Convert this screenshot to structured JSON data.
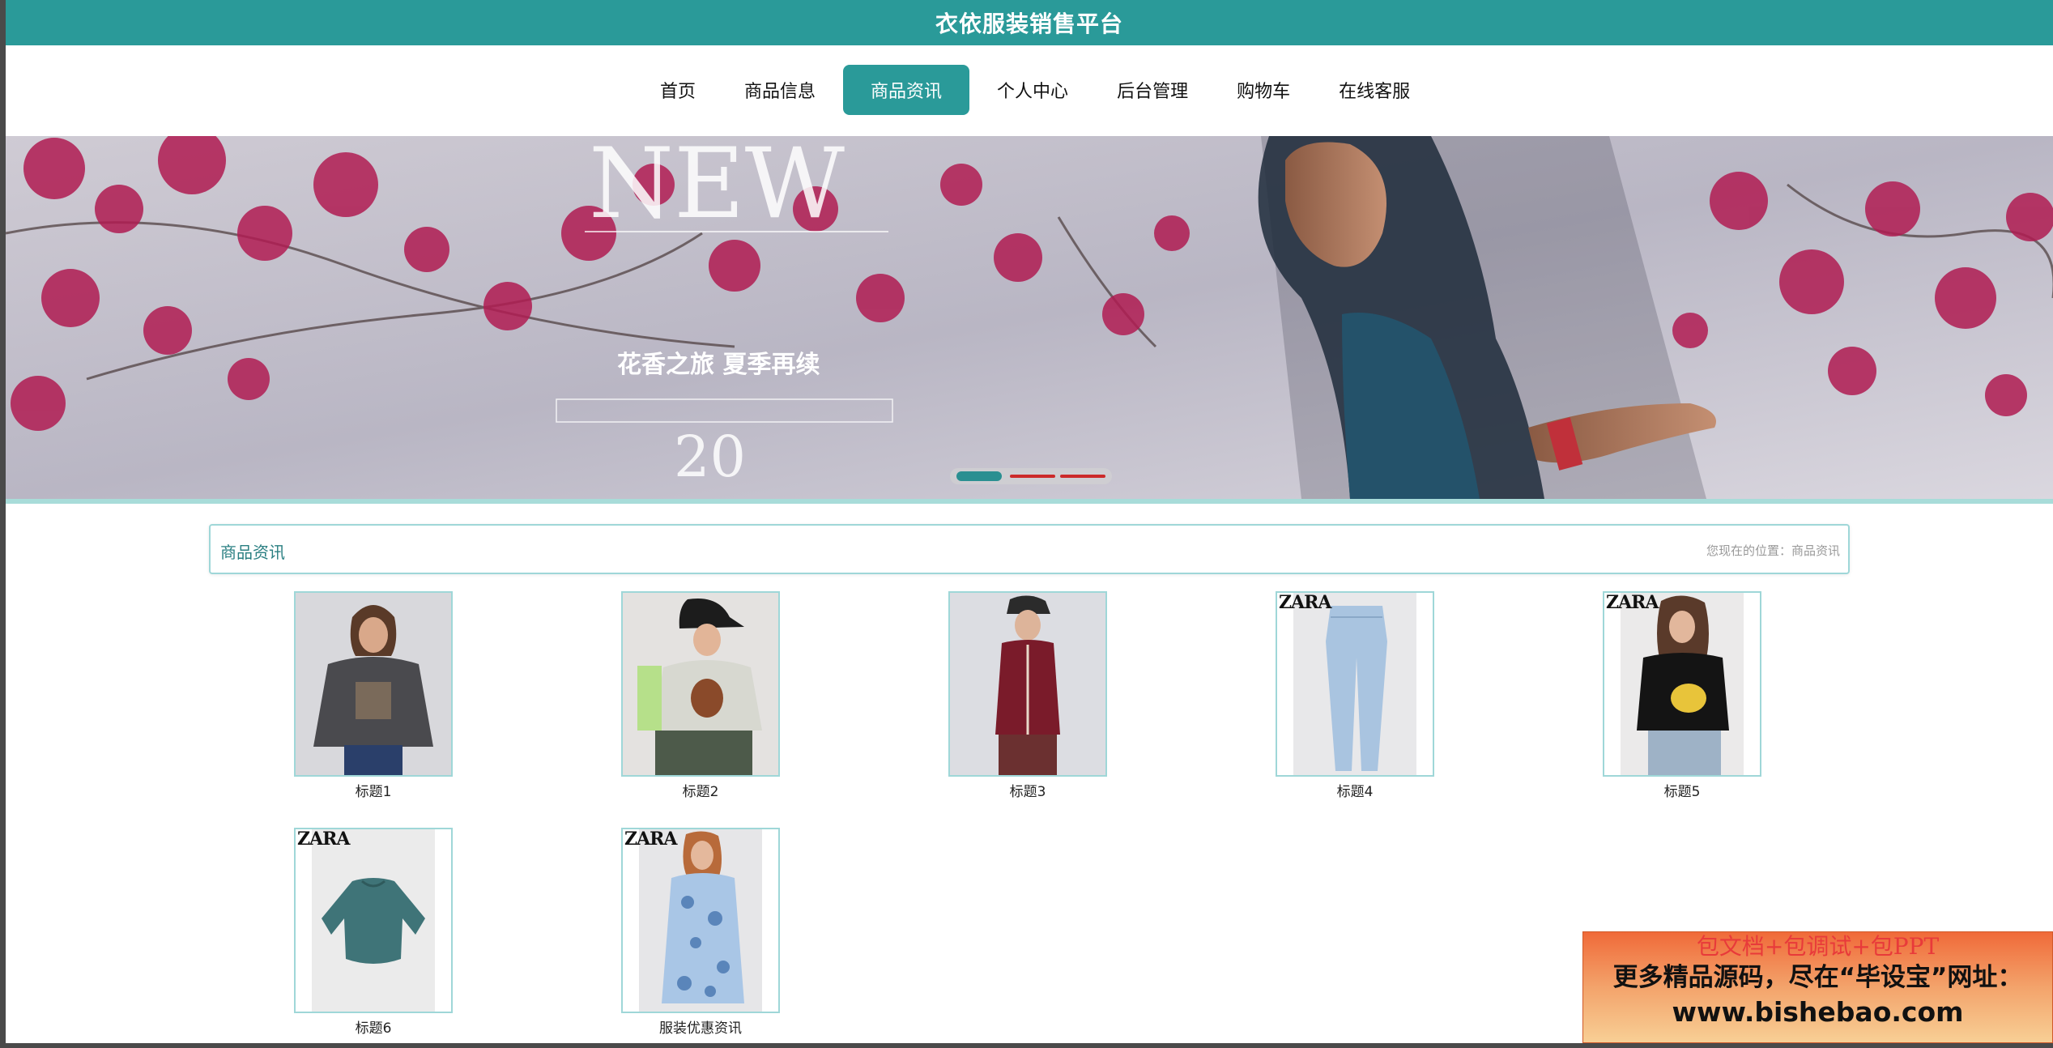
{
  "site": {
    "title": "衣依服装销售平台"
  },
  "nav": {
    "items": [
      {
        "label": "首页"
      },
      {
        "label": "商品信息"
      },
      {
        "label": "商品资讯",
        "active": true
      },
      {
        "label": "个人中心"
      },
      {
        "label": "后台管理"
      },
      {
        "label": "购物车"
      },
      {
        "label": "在线客服"
      }
    ]
  },
  "banner": {
    "headline": "NEW",
    "subhead": "花香之旅 夏季再续",
    "slides_total": 3,
    "active_slide": 1
  },
  "section": {
    "title": "商品资讯",
    "breadcrumb": "您现在的位置：商品资讯"
  },
  "products": [
    {
      "label": "标题1",
      "brand": ""
    },
    {
      "label": "标题2",
      "brand": ""
    },
    {
      "label": "标题3",
      "brand": ""
    },
    {
      "label": "标题4",
      "brand": "ZARA"
    },
    {
      "label": "标题5",
      "brand": "ZARA"
    },
    {
      "label": "标题6",
      "brand": "ZARA"
    },
    {
      "label": "服装优惠资讯",
      "brand": "ZARA"
    }
  ],
  "ad": {
    "line1": "包文档+包调试+包PPT",
    "line2": "更多精品源码，尽在“毕设宝”网址：",
    "line3": "www.bishebao.com"
  },
  "colors": {
    "primary": "#2a9a99",
    "accent": "#e83a3a"
  }
}
